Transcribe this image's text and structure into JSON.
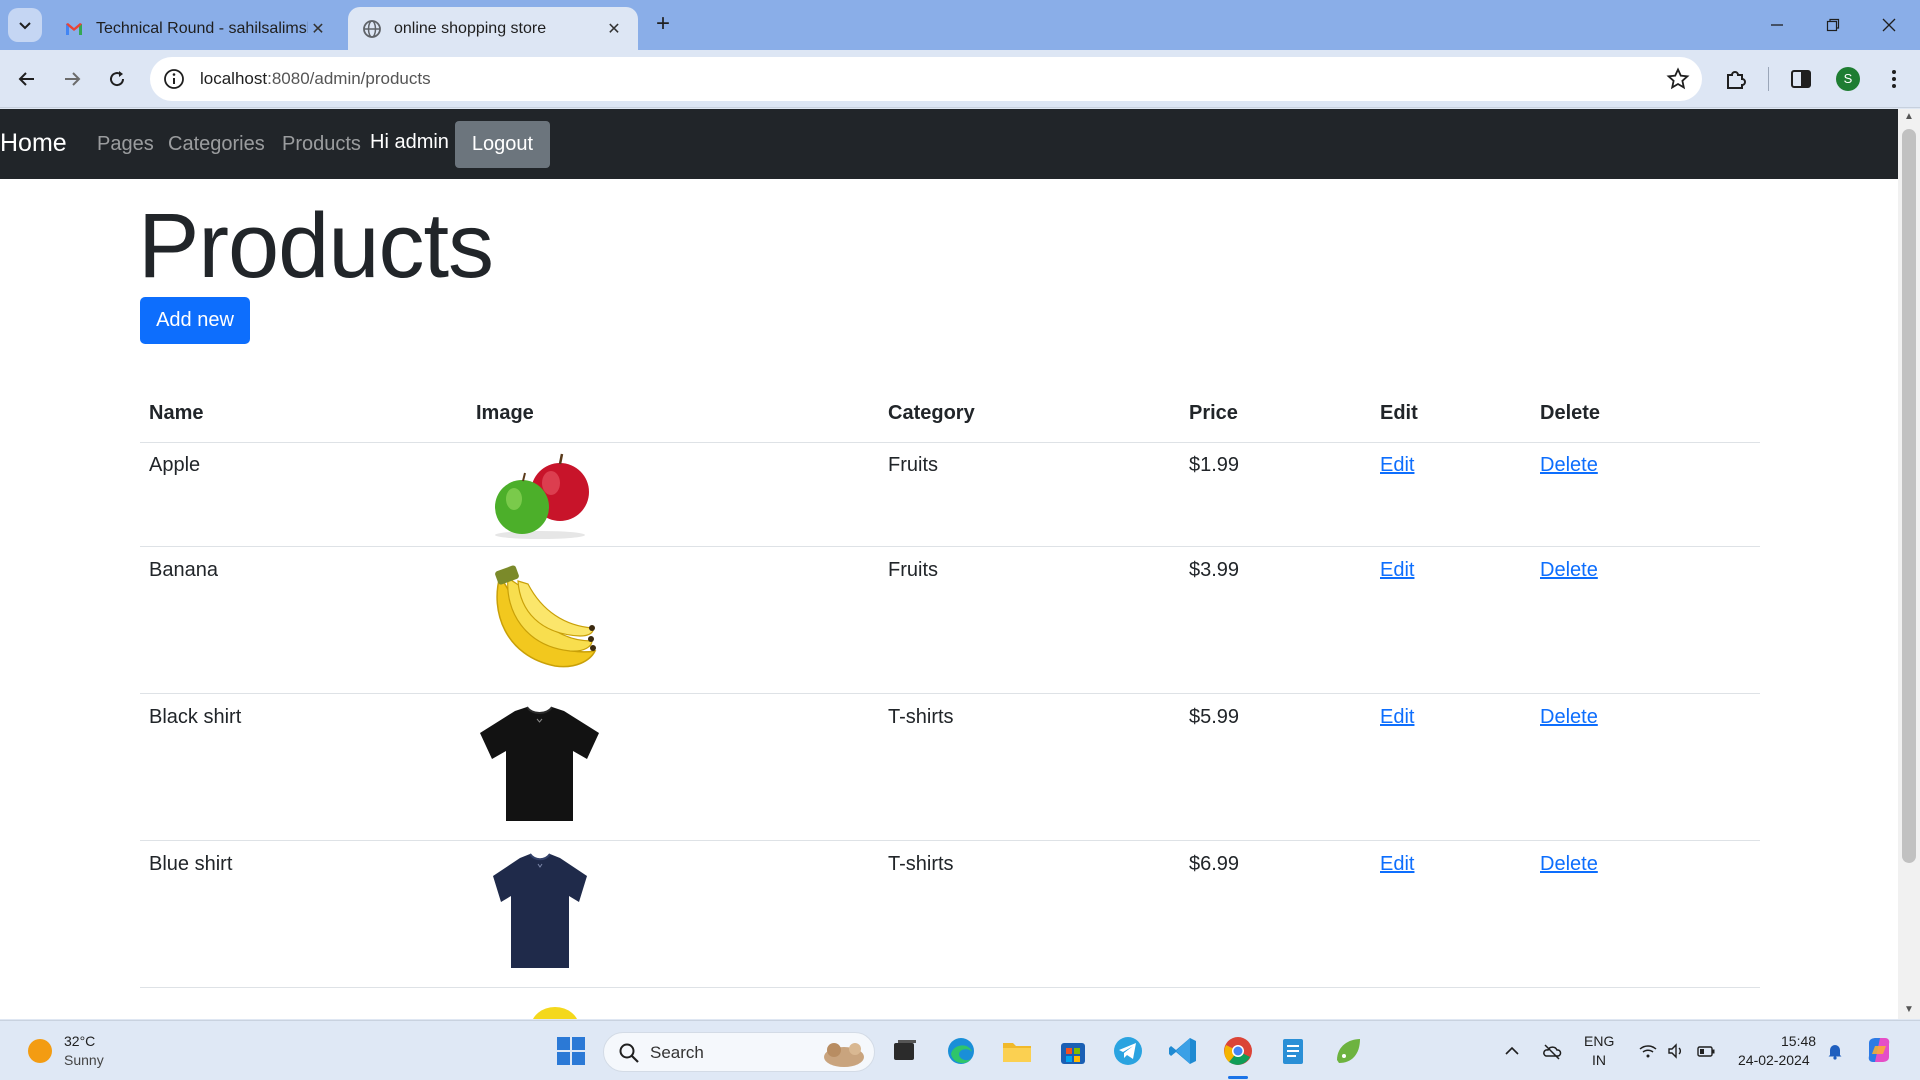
{
  "browser": {
    "tabs": [
      {
        "title": "Technical Round - sahilsalimsha",
        "icon": "gmail-icon",
        "active": false
      },
      {
        "title": "online shopping store",
        "icon": "globe-icon",
        "active": true
      }
    ],
    "url_host": "localhost",
    "url_path": ":8080/admin/products",
    "profile_initial": "S"
  },
  "nav": {
    "brand": "Home",
    "links": [
      "Pages",
      "Categories",
      "Products"
    ],
    "greeting": "Hi admin",
    "logout": "Logout"
  },
  "page": {
    "title": "Products",
    "add_button": "Add new"
  },
  "table": {
    "headers": [
      "Name",
      "Image",
      "Category",
      "Price",
      "Edit",
      "Delete"
    ],
    "rows": [
      {
        "name": "Apple",
        "image": "apple-image",
        "category": "Fruits",
        "price": "$1.99",
        "edit": "Edit",
        "delete": "Delete"
      },
      {
        "name": "Banana",
        "image": "banana-image",
        "category": "Fruits",
        "price": "$3.99",
        "edit": "Edit",
        "delete": "Delete"
      },
      {
        "name": "Black shirt",
        "image": "black-tshirt-image",
        "category": "T-shirts",
        "price": "$5.99",
        "edit": "Edit",
        "delete": "Delete"
      },
      {
        "name": "Blue shirt",
        "image": "blue-tshirt-image",
        "category": "T-shirts",
        "price": "$6.99",
        "edit": "Edit",
        "delete": "Delete"
      }
    ]
  },
  "taskbar": {
    "weather_temp": "32°C",
    "weather_desc": "Sunny",
    "search_label": "Search",
    "lang_1": "ENG",
    "lang_2": "IN",
    "time": "15:48",
    "date": "24-02-2024"
  },
  "colors": {
    "primary": "#0d6efd",
    "navbar": "#212529",
    "secondary": "#6c757d",
    "tabbar": "#8aaee8"
  }
}
